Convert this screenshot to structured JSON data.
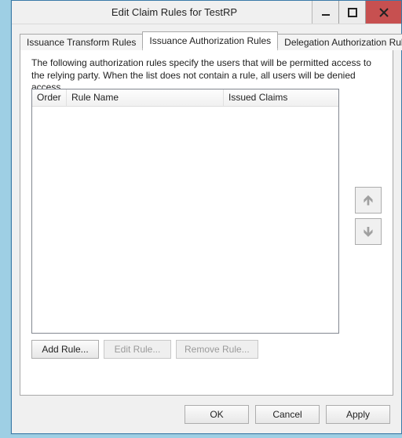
{
  "window": {
    "title": "Edit Claim Rules for TestRP"
  },
  "tabs": [
    {
      "label": "Issuance Transform Rules"
    },
    {
      "label": "Issuance Authorization Rules"
    },
    {
      "label": "Delegation Authorization Rules"
    }
  ],
  "panel": {
    "description": "The following authorization rules specify the users that will be permitted access to the relying party. When the list does not contain a rule, all users will be denied access.",
    "columns": {
      "order": "Order",
      "rule_name": "Rule Name",
      "issued_claims": "Issued Claims"
    },
    "rows": []
  },
  "buttons": {
    "add_rule": "Add Rule...",
    "edit_rule": "Edit Rule...",
    "remove_rule": "Remove Rule...",
    "ok": "OK",
    "cancel": "Cancel",
    "apply": "Apply"
  }
}
